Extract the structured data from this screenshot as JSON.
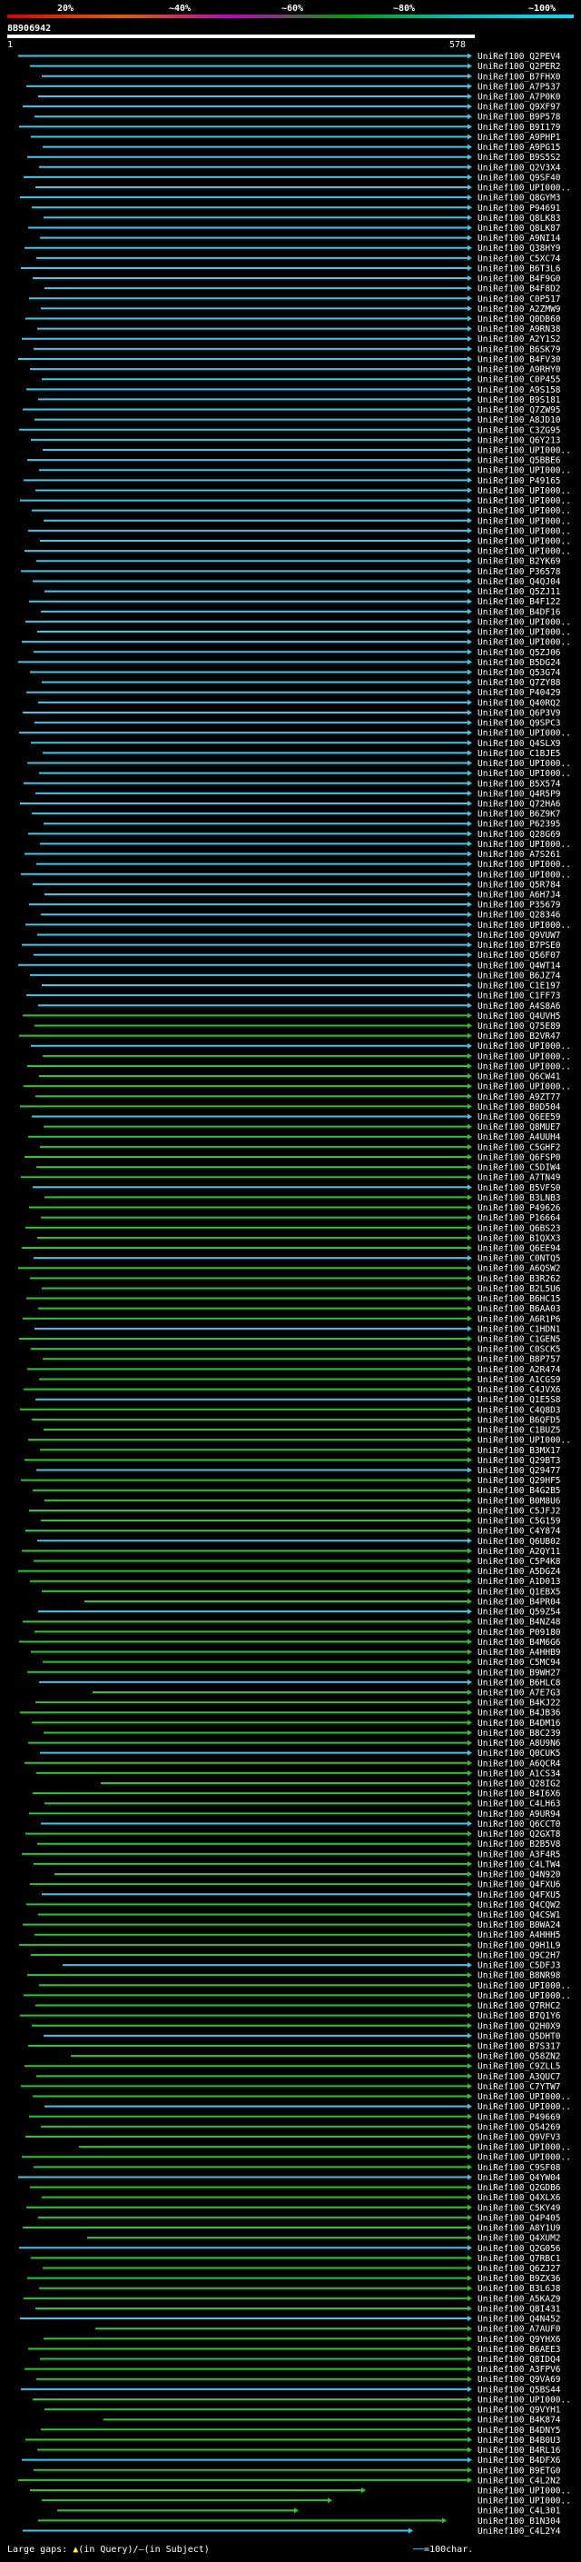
{
  "scale": {
    "labels": [
      "20%",
      "~40%",
      "~60%",
      "~80%",
      "~100%"
    ],
    "colors": [
      "#e00000",
      "#e06000",
      "#c000c0",
      "#00a000",
      "#00c0c0"
    ]
  },
  "query": {
    "id": "8B906942",
    "start": "1",
    "end": "578"
  },
  "colors": {
    "high": "#33ccee",
    "medium": "#22cc22",
    "qline": "#ffffff"
  },
  "hits": [
    "UniRef100_Q2PEV4",
    "UniRef100_Q2PER2",
    "UniRef100_B7FHX0",
    "UniRef100_A7P537",
    "UniRef100_A7P0K0",
    "UniRef100_Q9XF97",
    "UniRef100_B9P578",
    "UniRef100_B9I179",
    "UniRef100_A9PHP1",
    "UniRef100_A9PG15",
    "UniRef100_B9S5S2",
    "UniRef100_Q2V3X4",
    "UniRef100_Q9SF40",
    "UniRef100_UPI000..",
    "UniRef100_Q8GYM3",
    "UniRef100_P94691",
    "UniRef100_Q8LK83",
    "UniRef100_Q8LK87",
    "UniRef100_A9NI14",
    "UniRef100_Q38HY9",
    "UniRef100_C5XC74",
    "UniRef100_B6T3L6",
    "UniRef100_B4F9G0",
    "UniRef100_B4F8D2",
    "UniRef100_C0P517",
    "UniRef100_A2ZMW9",
    "UniRef100_Q0DB60",
    "UniRef100_A9RN38",
    "UniRef100_A2Y1S2",
    "UniRef100_B6SK79",
    "UniRef100_B4FV30",
    "UniRef100_A9RHY0",
    "UniRef100_C0P455",
    "UniRef100_A9S158",
    "UniRef100_B9S181",
    "UniRef100_Q7ZW95",
    "UniRef100_A8JD10",
    "UniRef100_C3ZG95",
    "UniRef100_Q6Y213",
    "UniRef100_UPI000..",
    "UniRef100_Q5BBE6",
    "UniRef100_UPI000..",
    "UniRef100_P49165",
    "UniRef100_UPI000..",
    "UniRef100_UPI000..",
    "UniRef100_UPI000..",
    "UniRef100_UPI000..",
    "UniRef100_UPI000..",
    "UniRef100_UPI000..",
    "UniRef100_UPI000..",
    "UniRef100_B2YK69",
    "UniRef100_P36578",
    "UniRef100_Q4QJ04",
    "UniRef100_Q5ZJ11",
    "UniRef100_B4F122",
    "UniRef100_B4DF16",
    "UniRef100_UPI000..",
    "UniRef100_UPI000..",
    "UniRef100_UPI000..",
    "UniRef100_Q5ZJ06",
    "UniRef100_B5DG24",
    "UniRef100_Q53G74",
    "UniRef100_Q7ZY88",
    "UniRef100_P40429",
    "UniRef100_Q40RQ2",
    "UniRef100_Q6P3V9",
    "UniRef100_Q9SPC3",
    "UniRef100_UPI000..",
    "UniRef100_Q4SLX9",
    "UniRef100_C1BJE5",
    "UniRef100_UPI000..",
    "UniRef100_UPI000..",
    "UniRef100_B5X574",
    "UniRef100_Q4R5P9",
    "UniRef100_Q72HA6",
    "UniRef100_B6Z9K7",
    "UniRef100_P62395",
    "UniRef100_Q28G69",
    "UniRef100_UPI000..",
    "UniRef100_A7S261",
    "UniRef100_UPI000..",
    "UniRef100_UPI000..",
    "UniRef100_Q5R784",
    "UniRef100_A6H7J4",
    "UniRef100_P35679",
    "UniRef100_Q28346",
    "UniRef100_UPI000..",
    "UniRef100_Q9VUW7",
    "UniRef100_B7PSE0",
    "UniRef100_Q56F07",
    "UniRef100_Q4WT14",
    "UniRef100_B6JZ74",
    "UniRef100_C1E197",
    "UniRef100_C1FF73",
    "UniRef100_A4S8A6",
    "UniRef100_Q4UVH5",
    "UniRef100_Q75E89",
    "UniRef100_B2VR47",
    "UniRef100_UPI000..",
    "UniRef100_UPI000..",
    "UniRef100_UPI000..",
    "UniRef100_Q6CW41",
    "UniRef100_UPI000..",
    "UniRef100_A9ZT77",
    "UniRef100_B0D504",
    "UniRef100_Q6EE59",
    "UniRef100_Q8MUE7",
    "UniRef100_A4UUH4",
    "UniRef100_C5GHF2",
    "UniRef100_Q6FSP0",
    "UniRef100_C5DIW4",
    "UniRef100_A7TN49",
    "UniRef100_B5VFS0",
    "UniRef100_B3LNB3",
    "UniRef100_P49626",
    "UniRef100_P16664",
    "UniRef100_Q6BS23",
    "UniRef100_B1QXX3",
    "UniRef100_Q6EE94",
    "UniRef100_C0NTQ5",
    "UniRef100_A6QSW2",
    "UniRef100_B3R262",
    "UniRef100_B2L5U6",
    "UniRef100_B6HC15",
    "UniRef100_B6AA03",
    "UniRef100_A6R1P6",
    "UniRef100_C1HDN1",
    "UniRef100_C1GEN5",
    "UniRef100_C0SCK5",
    "UniRef100_B8P757",
    "UniRef100_A2R474",
    "UniRef100_A1CGS9",
    "UniRef100_C4JVX6",
    "UniRef100_Q1E5S8",
    "UniRef100_C4Q8D3",
    "UniRef100_B6QFD5",
    "UniRef100_C1BUZ5",
    "UniRef100_UPI000..",
    "UniRef100_B3MX17",
    "UniRef100_Q29BT3",
    "UniRef100_Q29477",
    "UniRef100_Q29HF5",
    "UniRef100_B4G2B5",
    "UniRef100_B0M8U6",
    "UniRef100_C5JFJ2",
    "UniRef100_C5G159",
    "UniRef100_C4Y874",
    "UniRef100_Q6UB02",
    "UniRef100_A2QY11",
    "UniRef100_C5P4K8",
    "UniRef100_A5DGZ4",
    "UniRef100_A1D013",
    "UniRef100_Q1EBX5",
    "UniRef100_B4PR04",
    "UniRef100_Q59Z54",
    "UniRef100_B4NZ48",
    "UniRef100_P09180",
    "UniRef100_B4M6G6",
    "UniRef100_A4HHB9",
    "UniRef100_C5MC94",
    "UniRef100_B9WH27",
    "UniRef100_B6HLC8",
    "UniRef100_A7E7G3",
    "UniRef100_B4KJ22",
    "UniRef100_B4JB36",
    "UniRef100_B4DM16",
    "UniRef100_B8C239",
    "UniRef100_A8U9N6",
    "UniRef100_Q0CUK5",
    "UniRef100_A6QCR4",
    "UniRef100_A1CS34",
    "UniRef100_Q28IG2",
    "UniRef100_B4I6X6",
    "UniRef100_C4LH63",
    "UniRef100_A9UR94",
    "UniRef100_Q6CCT0",
    "UniRef100_Q2GXT8",
    "UniRef100_B2B5V8",
    "UniRef100_A3F4R5",
    "UniRef100_C4LTW4",
    "UniRef100_Q4N920",
    "UniRef100_Q4FXU6",
    "UniRef100_Q4FXU5",
    "UniRef100_Q4CQW2",
    "UniRef100_Q4CSW1",
    "UniRef100_B0WA24",
    "UniRef100_A4HHH5",
    "UniRef100_Q9H1L9",
    "UniRef100_Q9C2H7",
    "UniRef100_C5DFJ3",
    "UniRef100_B8NR98",
    "UniRef100_UPI000..",
    "UniRef100_UPI000..",
    "UniRef100_Q7RHC2",
    "UniRef100_B7Q1Y6",
    "UniRef100_Q2H0X9",
    "UniRef100_Q5DHT0",
    "UniRef100_B7S317",
    "UniRef100_Q58ZN2",
    "UniRef100_C9ZLL5",
    "UniRef100_A3QUC7",
    "UniRef100_C7YTW7",
    "UniRef100_UPI000..",
    "UniRef100_UPI000..",
    "UniRef100_P49669",
    "UniRef100_Q54269",
    "UniRef100_Q9VFV3",
    "UniRef100_UPI000..",
    "UniRef100_UPI000..",
    "UniRef100_C9SF08",
    "UniRef100_Q4YW04",
    "UniRef100_Q2GDB6",
    "UniRef100_Q4XLX6",
    "UniRef100_C5KY49",
    "UniRef100_Q4P405",
    "UniRef100_A8Y1U9",
    "UniRef100_Q4XUM2",
    "UniRef100_Q2G056",
    "UniRef100_Q7RBC1",
    "UniRef100_Q6ZJ27",
    "UniRef100_B9ZX36",
    "UniRef100_B3L6J8",
    "UniRef100_A5KAZ9",
    "UniRef100_Q8I431",
    "UniRef100_Q4N452",
    "UniRef100_A7AUF0",
    "UniRef100_Q9YHX6",
    "UniRef100_B6AEE3",
    "UniRef100_Q8IDQ4",
    "UniRef100_A3FPV6",
    "UniRef100_Q9VA69",
    "UniRef100_Q5BS44",
    "UniRef100_UPI000..",
    "UniRef100_Q9VYH1",
    "UniRef100_B4K874",
    "UniRef100_B4DNY5",
    "UniRef100_B4B0U3",
    "UniRef100_B4RL16",
    "UniRef100_B4DFX6",
    "UniRef100_B9ETG0",
    "UniRef100_C4L2N2",
    "UniRef100_UPI000..",
    "UniRef100_UPI000..",
    "UniRef100_C4L301",
    "UniRef100_B1N304",
    "UniRef100_C4L2Y4"
  ],
  "legend": {
    "gaps_label": "Large gaps:",
    "gaps_query": "(in Query)",
    "gaps_sep": "/",
    "gaps_subject": "(in Subject)",
    "scale_label": "=100char."
  }
}
